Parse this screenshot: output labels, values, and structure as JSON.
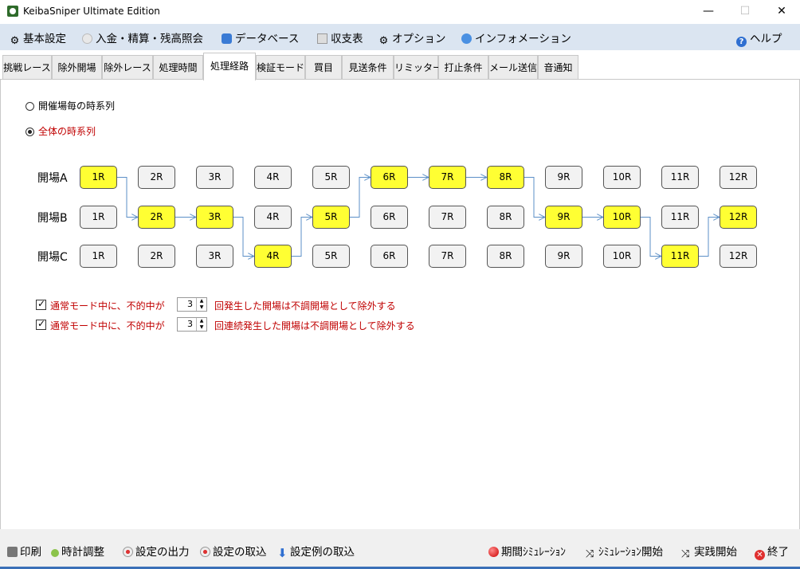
{
  "window": {
    "title": "KeibaSniper Ultimate Edition",
    "minimize": "—",
    "maximize": "☐",
    "close": "✕"
  },
  "menu": {
    "items": [
      "基本設定",
      "入金・精算・残高照会",
      "データベース",
      "収支表",
      "オプション",
      "インフォメーション"
    ],
    "help": "ヘルプ"
  },
  "tabs": [
    "挑戦レース",
    "除外開場",
    "除外レース",
    "処理時間",
    "処理経路",
    "検証モード",
    "買目",
    "見送条件",
    "リミッター",
    "打止条件",
    "メール送信",
    "音通知"
  ],
  "active_tab": "処理経路",
  "route": {
    "radio1": "開催場毎の時系列",
    "radio2": "全体の時系列",
    "selected": "全体の時系列",
    "venues": [
      {
        "label": "開場A",
        "races": [
          "1R",
          "2R",
          "3R",
          "4R",
          "5R",
          "6R",
          "7R",
          "8R",
          "9R",
          "10R",
          "11R",
          "12R"
        ],
        "highlight": [
          1,
          6,
          7,
          8
        ]
      },
      {
        "label": "開場B",
        "races": [
          "1R",
          "2R",
          "3R",
          "4R",
          "5R",
          "6R",
          "7R",
          "8R",
          "9R",
          "10R",
          "11R",
          "12R"
        ],
        "highlight": [
          2,
          3,
          5,
          9,
          10,
          12
        ]
      },
      {
        "label": "開場C",
        "races": [
          "1R",
          "2R",
          "3R",
          "4R",
          "5R",
          "6R",
          "7R",
          "8R",
          "9R",
          "10R",
          "11R",
          "12R"
        ],
        "highlight": [
          4,
          11
        ]
      }
    ],
    "path": [
      "A1",
      "B2",
      "B3",
      "C4",
      "B5",
      "A6",
      "A7",
      "A8",
      "B9",
      "B10",
      "C11",
      "B12"
    ],
    "highlight_color": "#ffff33",
    "line_color": "#5b8fc7"
  },
  "options": [
    {
      "checked": true,
      "pre": "通常モード中に、不的中が",
      "value": "3",
      "post": "回発生した開場は不調開場として除外する"
    },
    {
      "checked": true,
      "pre": "通常モード中に、不的中が",
      "value": "3",
      "post": "回連続発生した開場は不調開場として除外する"
    }
  ],
  "bottom": {
    "print": "印刷",
    "clock": "時計調整",
    "export": "設定の出力",
    "import": "設定の取込",
    "import_example": "設定例の取込",
    "period_sim": "期間ｼﾐｭﾚｰｼｮﾝ",
    "sim_start": "ｼﾐｭﾚｰｼｮﾝ開始",
    "live_start": "実践開始",
    "exit": "終了"
  }
}
